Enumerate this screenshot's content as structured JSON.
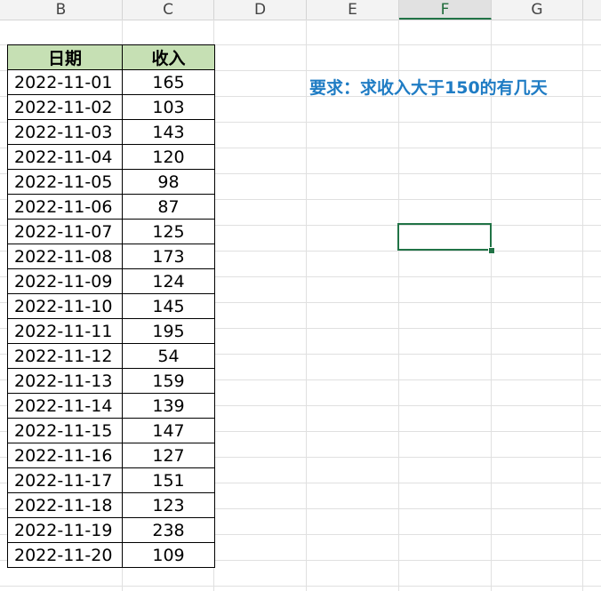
{
  "columns": [
    "B",
    "C",
    "D",
    "E",
    "F",
    "G"
  ],
  "selected_column": "F",
  "table": {
    "headers": [
      "日期",
      "收入"
    ],
    "rows": [
      [
        "2022-11-01",
        "165"
      ],
      [
        "2022-11-02",
        "103"
      ],
      [
        "2022-11-03",
        "143"
      ],
      [
        "2022-11-04",
        "120"
      ],
      [
        "2022-11-05",
        "98"
      ],
      [
        "2022-11-06",
        "87"
      ],
      [
        "2022-11-07",
        "125"
      ],
      [
        "2022-11-08",
        "173"
      ],
      [
        "2022-11-09",
        "124"
      ],
      [
        "2022-11-10",
        "145"
      ],
      [
        "2022-11-11",
        "195"
      ],
      [
        "2022-11-12",
        "54"
      ],
      [
        "2022-11-13",
        "159"
      ],
      [
        "2022-11-14",
        "139"
      ],
      [
        "2022-11-15",
        "147"
      ],
      [
        "2022-11-16",
        "127"
      ],
      [
        "2022-11-17",
        "151"
      ],
      [
        "2022-11-18",
        "123"
      ],
      [
        "2022-11-19",
        "238"
      ],
      [
        "2022-11-20",
        "109"
      ]
    ]
  },
  "note": {
    "text": "要求：求收入大于150的有几天"
  },
  "colors": {
    "header_fill": "#c6e0b4",
    "note_text": "#1f7cc4",
    "selection": "#217346"
  }
}
